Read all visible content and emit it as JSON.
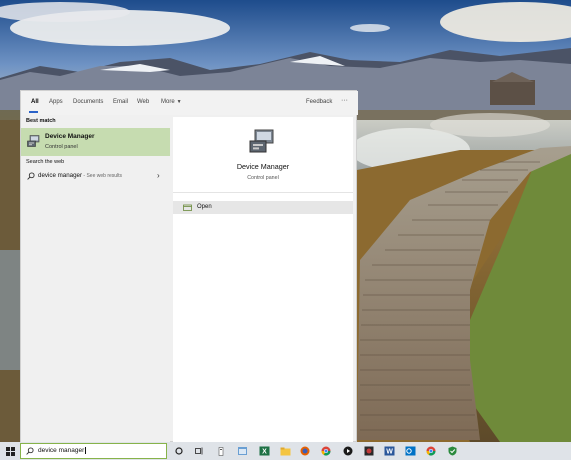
{
  "search_panel": {
    "tabs": [
      {
        "label": "All",
        "active": true
      },
      {
        "label": "Apps"
      },
      {
        "label": "Documents"
      },
      {
        "label": "Email"
      },
      {
        "label": "Web"
      },
      {
        "label": "More"
      }
    ],
    "feedback_label": "Feedback",
    "options_label": "···",
    "best_match": {
      "section_label": "Best match",
      "title": "Device Manager",
      "subtitle": "Control panel",
      "icon": "device-manager-icon"
    },
    "web": {
      "section_label": "Search the web",
      "query": "device manager",
      "hint": " - See web results",
      "icon": "search-icon"
    },
    "preview": {
      "title": "Device Manager",
      "subtitle": "Control panel",
      "icon": "device-manager-icon"
    },
    "actions": [
      {
        "label": "Open",
        "icon": "open-icon"
      }
    ]
  },
  "taskbar": {
    "search_value": "device manager",
    "accent": "#87b34a",
    "apps": [
      "start-icon",
      "cortana-icon",
      "task-view-icon",
      "people-icon",
      "files-app-icon",
      "excel-icon",
      "file-explorer-icon",
      "firefox-icon",
      "chrome-icon",
      "media-app-icon",
      "music-app-icon",
      "word-icon",
      "outlook-icon",
      "chrome-icon",
      "shield-app-icon"
    ]
  },
  "colors": {
    "selection_green": "#c6dcb0",
    "tab_accent": "#2a62c8",
    "panel_bg": "#f0f0f0"
  }
}
